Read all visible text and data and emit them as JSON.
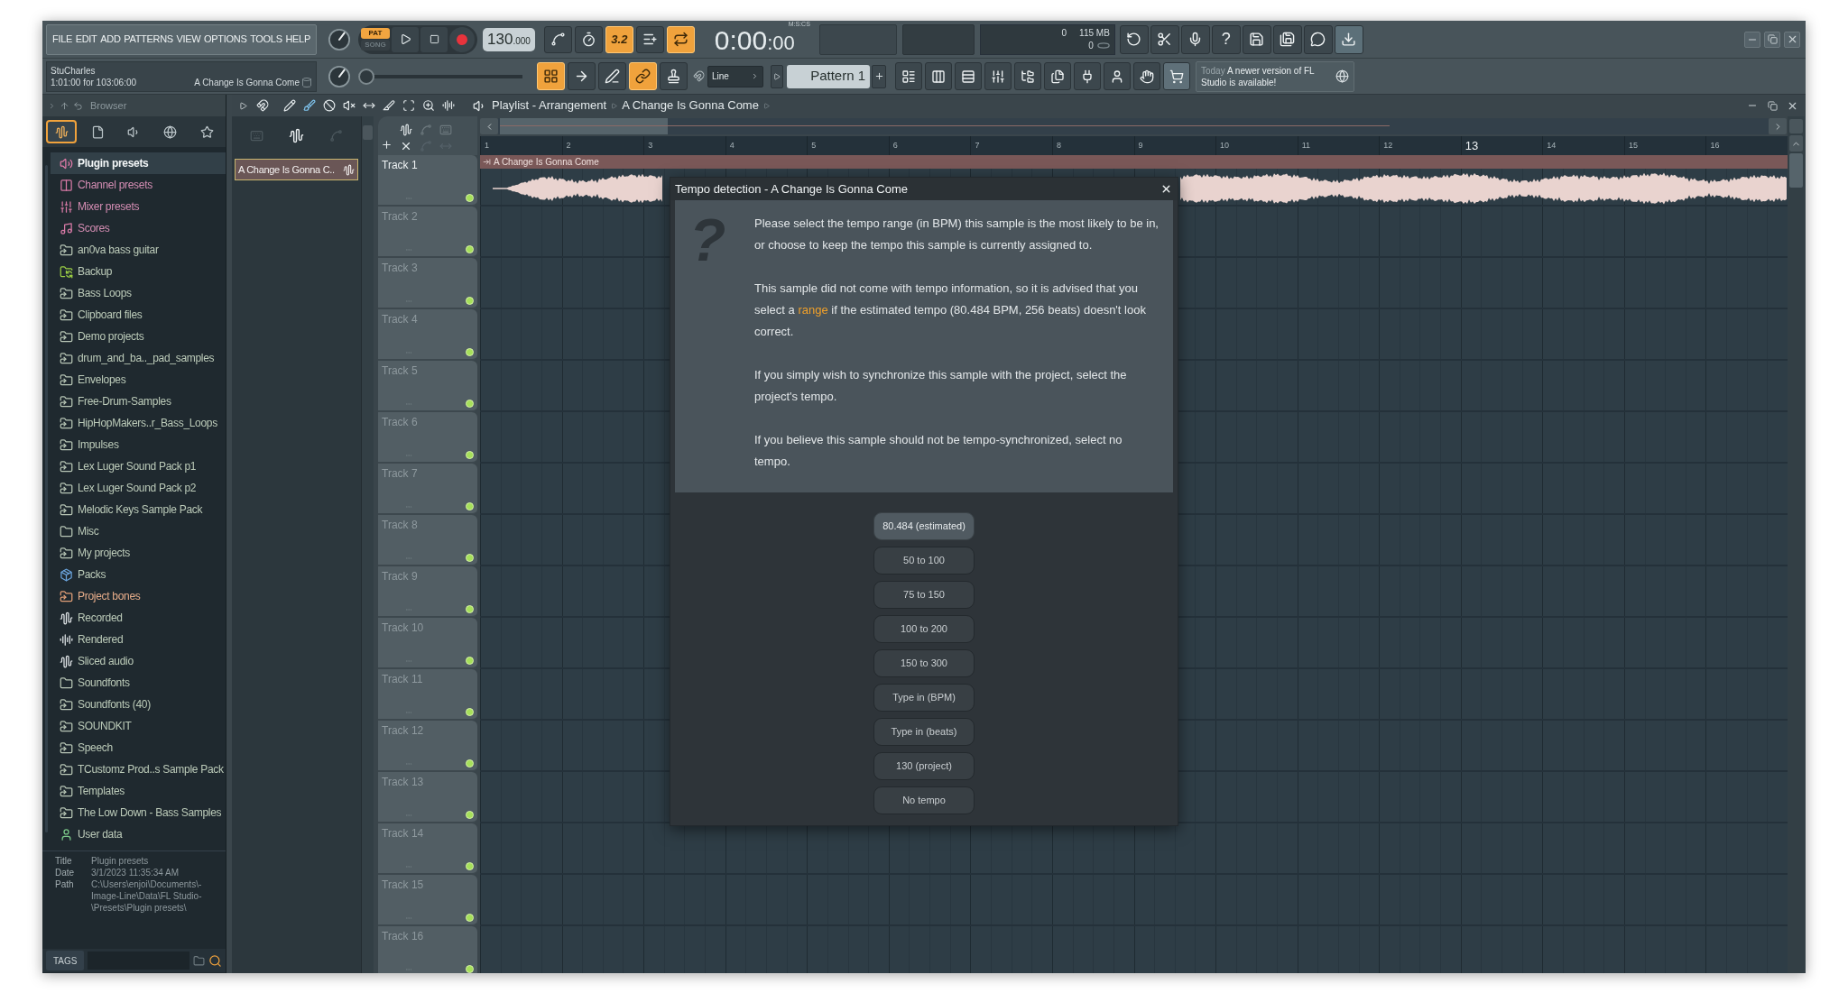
{
  "menu": [
    "FILE",
    "EDIT",
    "ADD",
    "PATTERNS",
    "VIEW",
    "OPTIONS",
    "TOOLS",
    "HELP"
  ],
  "transport": {
    "modes": [
      {
        "label": "PAT",
        "selected": true
      },
      {
        "label": "SONG",
        "selected": false
      }
    ],
    "tempo": "130",
    "tempo_fraction": ".000"
  },
  "toggles": [
    {
      "kind": "icon",
      "on": false
    },
    {
      "kind": "icon",
      "on": false
    },
    {
      "kind": "text",
      "label": "3.2",
      "on": true
    },
    {
      "kind": "icon",
      "on": false
    },
    {
      "kind": "icon",
      "on": true
    }
  ],
  "time": {
    "main": "0:00",
    "fraction": ":00",
    "unit": "M:S:CS"
  },
  "cpu": {
    "value": "0",
    "memory": "115 MB",
    "polyphony": "0"
  },
  "tool_buttons": [
    {
      "kind": "icon"
    },
    {
      "kind": "icon"
    },
    {
      "kind": "icon"
    },
    {
      "kind": "text",
      "label": "?"
    },
    {
      "kind": "icon"
    },
    {
      "kind": "icon"
    },
    {
      "kind": "icon"
    },
    {
      "kind": "icon"
    }
  ],
  "hint": {
    "user": "StuCharles",
    "position": "1:01:00 for 103:06:00",
    "song": "A Change Is Gonna Come"
  },
  "pitch_slider": {
    "level": 0
  },
  "pattern_tools": [
    {
      "on": true
    },
    {
      "on": false
    },
    {
      "on": false
    },
    {
      "on": true
    },
    {
      "on": false
    }
  ],
  "snap": {
    "value": "Line"
  },
  "pattern": {
    "name": "Pattern 1"
  },
  "news": {
    "when": "Today",
    "message": "A newer version of FL Studio is available!"
  },
  "browser": {
    "title": "Browser",
    "tabs": [
      {
        "selected": true
      },
      {
        "selected": false
      },
      {
        "selected": false
      },
      {
        "selected": false
      },
      {
        "selected": false
      }
    ],
    "items": [
      {
        "name": "Plugin presets",
        "kind": "plugin",
        "selected": true
      },
      {
        "name": "Channel presets",
        "kind": "channel",
        "selected": false
      },
      {
        "name": "Mixer presets",
        "kind": "mixer",
        "selected": false
      },
      {
        "name": "Scores",
        "kind": "score",
        "selected": false
      },
      {
        "name": "an0va bass guitar",
        "kind": "folder_link",
        "selected": false
      },
      {
        "name": "Backup",
        "kind": "backup",
        "selected": false
      },
      {
        "name": "Bass Loops",
        "kind": "folder_link",
        "selected": false
      },
      {
        "name": "Clipboard files",
        "kind": "folder_link",
        "selected": false
      },
      {
        "name": "Demo projects",
        "kind": "folder_link",
        "selected": false
      },
      {
        "name": "drum_and_ba.._pad_samples",
        "kind": "folder_link",
        "selected": false
      },
      {
        "name": "Envelopes",
        "kind": "folder_link",
        "selected": false
      },
      {
        "name": "Free-Drum-Samples",
        "kind": "folder_link",
        "selected": false
      },
      {
        "name": "HipHopMakers..r_Bass_Loops",
        "kind": "folder_link",
        "selected": false
      },
      {
        "name": "Impulses",
        "kind": "folder_link",
        "selected": false
      },
      {
        "name": "Lex Luger Sound Pack p1",
        "kind": "folder_link",
        "selected": false
      },
      {
        "name": "Lex Luger Sound Pack p2",
        "kind": "folder_link",
        "selected": false
      },
      {
        "name": "Melodic Keys Sample Pack",
        "kind": "folder_link",
        "selected": false
      },
      {
        "name": "Misc",
        "kind": "folder",
        "selected": false
      },
      {
        "name": "My projects",
        "kind": "folder_link",
        "selected": false
      },
      {
        "name": "Packs",
        "kind": "packs",
        "selected": false
      },
      {
        "name": "Project bones",
        "kind": "bones",
        "selected": false
      },
      {
        "name": "Recorded",
        "kind": "audio",
        "selected": false
      },
      {
        "name": "Rendered",
        "kind": "rendered",
        "selected": false
      },
      {
        "name": "Sliced audio",
        "kind": "audio",
        "selected": false
      },
      {
        "name": "Soundfonts",
        "kind": "folder",
        "selected": false
      },
      {
        "name": "Soundfonts (40)",
        "kind": "folder_link",
        "selected": false
      },
      {
        "name": "SOUNDKIT",
        "kind": "folder_link",
        "selected": false
      },
      {
        "name": "Speech",
        "kind": "folder_link",
        "selected": false
      },
      {
        "name": "TCustomz Prod..s Sample Pack",
        "kind": "folder_link",
        "selected": false
      },
      {
        "name": "Templates",
        "kind": "folder_link",
        "selected": false
      },
      {
        "name": "The Low Down - Bass Samples",
        "kind": "folder_link",
        "selected": false
      },
      {
        "name": "User data",
        "kind": "user",
        "selected": false
      }
    ],
    "info": [
      {
        "label": "Title",
        "lines": [
          "Plugin presets"
        ]
      },
      {
        "label": "Date",
        "lines": [
          "3/1/2023 11:35:34 AM"
        ]
      },
      {
        "label": "Path",
        "lines": [
          "C:\\Users\\enjoi\\Documents\\-",
          "Image-Line\\Data\\FL Studio-",
          "\\Presets\\Plugin presets\\"
        ]
      }
    ],
    "tags": "TAGS"
  },
  "playlist": {
    "title": "Playlist - Arrangement",
    "breadcrumb": "A Change Is Gonna Come",
    "clips": [
      {
        "name": "A Change Is Gonna C..",
        "selected": true
      }
    ],
    "ruler": [
      {
        "label": "1",
        "highlighted": false
      },
      {
        "label": "2",
        "highlighted": false
      },
      {
        "label": "3",
        "highlighted": false
      },
      {
        "label": "4",
        "highlighted": false
      },
      {
        "label": "5",
        "highlighted": false
      },
      {
        "label": "6",
        "highlighted": false
      },
      {
        "label": "7",
        "highlighted": false
      },
      {
        "label": "8",
        "highlighted": false
      },
      {
        "label": "9",
        "highlighted": false
      },
      {
        "label": "10",
        "highlighted": false
      },
      {
        "label": "11",
        "highlighted": false
      },
      {
        "label": "12",
        "highlighted": false
      },
      {
        "label": "13",
        "highlighted": true
      },
      {
        "label": "14",
        "highlighted": false
      },
      {
        "label": "15",
        "highlighted": false
      },
      {
        "label": "16",
        "highlighted": false
      }
    ],
    "clip_name": "A Change Is Gonna Come",
    "tracks": [
      {
        "name": "Track 1",
        "active": true,
        "on": true
      },
      {
        "name": "Track 2",
        "active": false,
        "on": true
      },
      {
        "name": "Track 3",
        "active": false,
        "on": true
      },
      {
        "name": "Track 4",
        "active": false,
        "on": true
      },
      {
        "name": "Track 5",
        "active": false,
        "on": true
      },
      {
        "name": "Track 6",
        "active": false,
        "on": true
      },
      {
        "name": "Track 7",
        "active": false,
        "on": true
      },
      {
        "name": "Track 8",
        "active": false,
        "on": true
      },
      {
        "name": "Track 9",
        "active": false,
        "on": true
      },
      {
        "name": "Track 10",
        "active": false,
        "on": true
      },
      {
        "name": "Track 11",
        "active": false,
        "on": true
      },
      {
        "name": "Track 12",
        "active": false,
        "on": true
      },
      {
        "name": "Track 13",
        "active": false,
        "on": true
      },
      {
        "name": "Track 14",
        "active": false,
        "on": true
      },
      {
        "name": "Track 15",
        "active": false,
        "on": true
      },
      {
        "name": "Track 16",
        "active": false,
        "on": true
      }
    ]
  },
  "dialog": {
    "title": "Tempo detection - A Change Is Gonna Come",
    "glyph": "?",
    "paragraphs": [
      [
        {
          "text": "Please select the tempo range (in BPM) this sample is the most likely to be in, or choose to keep the tempo this sample is currently assigned to."
        }
      ],
      [
        {
          "text": "This sample did not come with tempo information, so it is advised that you select a "
        },
        {
          "text": "range",
          "kind": "link"
        },
        {
          "text": " if the estimated tempo (80.484 BPM, 256 beats) doesn't look correct."
        }
      ],
      [
        {
          "text": "If you simply wish to synchronize this sample with the project, select the project's tempo."
        }
      ],
      [
        {
          "text": "If you believe this sample should not be tempo-synchronized, select no tempo."
        }
      ]
    ],
    "options": [
      {
        "label": "80.484 (estimated)",
        "selected": true
      },
      {
        "label": "50 to 100",
        "selected": false
      },
      {
        "label": "75 to 150",
        "selected": false
      },
      {
        "label": "100 to 200",
        "selected": false
      },
      {
        "label": "150 to 300",
        "selected": false
      },
      {
        "label": "Type in (BPM)",
        "selected": false
      },
      {
        "label": "Type in (beats)",
        "selected": false
      },
      {
        "label": "130 (project)",
        "selected": false
      },
      {
        "label": "No tempo",
        "selected": false
      }
    ]
  }
}
